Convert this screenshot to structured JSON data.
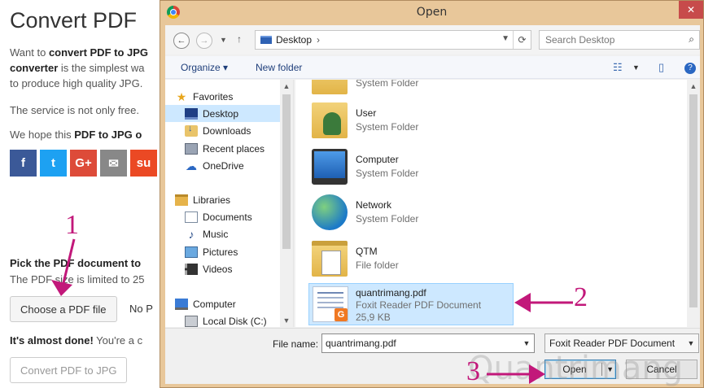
{
  "webpage": {
    "title": "Convert PDF",
    "intro_1": "Want to ",
    "intro_bold_1": "convert PDF to JPG",
    "intro_2": "converter",
    "intro_3": " is the simplest wa",
    "intro_4": "to produce high quality JPG.",
    "service_text": "The service is not only free.",
    "hope_prefix": "We hope this ",
    "hope_bold": "PDF to JPG o",
    "social_icons": [
      "facebook-icon",
      "twitter-icon",
      "google-plus-icon",
      "email-icon",
      "stumbleupon-icon"
    ],
    "social_glyphs": [
      "f",
      "t",
      "G+",
      "✉",
      "su"
    ],
    "social_colors": [
      "#3b5998",
      "#1da1f2",
      "#dd4b39",
      "#888888",
      "#eb4924"
    ],
    "pick_text": "Pick the PDF document to",
    "limit_text": "The PDF size is limited to 25",
    "choose_button": "Choose a PDF file",
    "no_file_text": "No P",
    "almost_bold": "It's almost done!",
    "almost_text": " You're a c",
    "convert_button": "Convert PDF to JPG"
  },
  "dialog": {
    "title": "Open",
    "close_glyph": "✕",
    "address_path": "Desktop",
    "search_placeholder": "Search Desktop",
    "toolbar": {
      "organize": "Organize ▾",
      "new_folder": "New folder"
    },
    "nav_tree": [
      {
        "label": "Favorites",
        "icon": "star-icon"
      },
      {
        "label": "Desktop",
        "icon": "desktop-icon",
        "selected": true
      },
      {
        "label": "Downloads",
        "icon": "downloads-icon"
      },
      {
        "label": "Recent places",
        "icon": "recent-places-icon"
      },
      {
        "label": "OneDrive",
        "icon": "onedrive-icon"
      },
      {
        "label": "Libraries",
        "icon": "libraries-icon"
      },
      {
        "label": "Documents",
        "icon": "documents-icon"
      },
      {
        "label": "Music",
        "icon": "music-icon"
      },
      {
        "label": "Pictures",
        "icon": "pictures-icon"
      },
      {
        "label": "Videos",
        "icon": "videos-icon"
      },
      {
        "label": "Computer",
        "icon": "computer-icon"
      },
      {
        "label": "Local Disk (C:)",
        "icon": "disk-icon"
      }
    ],
    "files": [
      {
        "name": "",
        "type": "System Folder",
        "icon": "system-folder-icon"
      },
      {
        "name": "User",
        "type": "System Folder",
        "icon": "user-folder-icon"
      },
      {
        "name": "Computer",
        "type": "System Folder",
        "icon": "computer-icon"
      },
      {
        "name": "Network",
        "type": "System Folder",
        "icon": "network-icon"
      },
      {
        "name": "QTM",
        "type": "File folder",
        "icon": "folder-icon"
      },
      {
        "name": "quantrimang.pdf",
        "type": "Foxit Reader PDF Document",
        "size": "25,9 KB",
        "icon": "pdf-file-icon",
        "selected": true
      }
    ],
    "file_name_label": "File name:",
    "file_name_value": "quantrimang.pdf",
    "file_type_value": "Foxit Reader PDF Document",
    "open_button": "Open",
    "cancel_button": "Cancel",
    "watermark": "Quantrimang"
  },
  "annotations": {
    "step1": "1",
    "step2": "2",
    "step3": "3",
    "color": "#c2187a"
  }
}
